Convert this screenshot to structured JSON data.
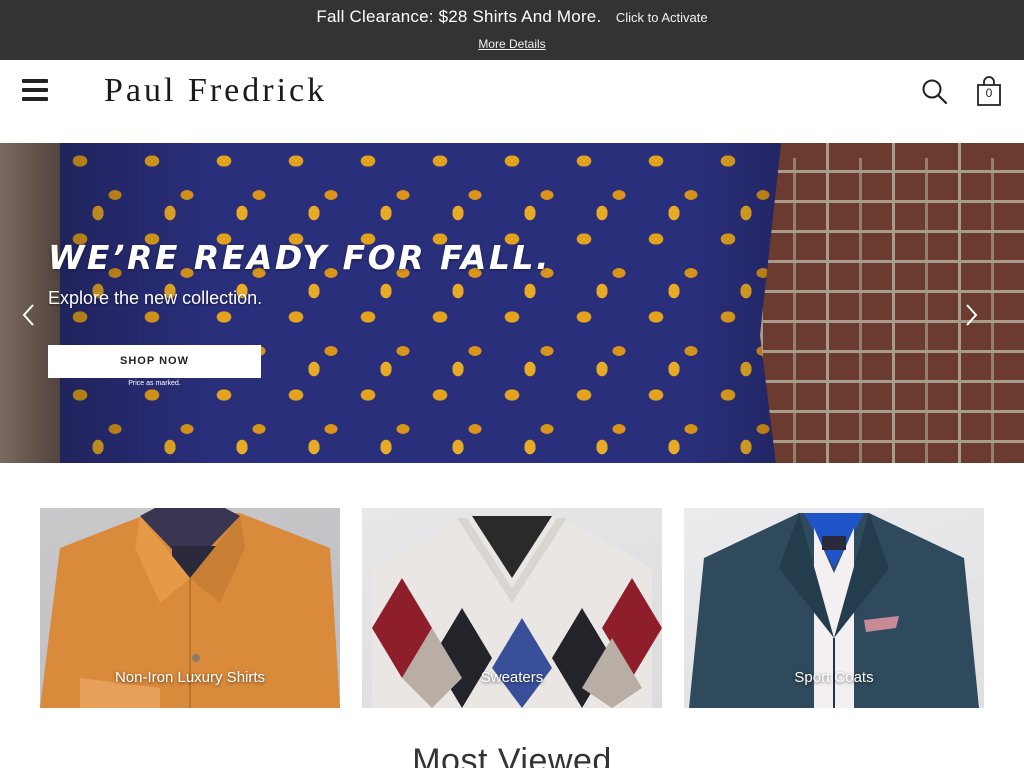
{
  "promo": {
    "title": "Fall Clearance: $28 Shirts And More.",
    "activate_label": "Click to Activate",
    "details_label": "More Details"
  },
  "header": {
    "logo_text": "Paul Fredrick",
    "menu_icon": "hamburger-menu-icon",
    "search_icon": "search-icon",
    "bag_icon": "shopping-bag-icon",
    "bag_count": "0"
  },
  "hero": {
    "headline": "WE’RE READY FOR FALL.",
    "subheadline": "Explore the new collection.",
    "cta_label": "SHOP NOW",
    "note": "Price as marked.",
    "prev_icon": "chevron-left-icon",
    "next_icon": "chevron-right-icon"
  },
  "categories": [
    {
      "label": "Non-Iron Luxury Shirts"
    },
    {
      "label": "Sweaters"
    },
    {
      "label": "Sport Coats"
    }
  ],
  "section_heading": "Most Viewed",
  "colors": {
    "promo_bg": "#333333",
    "shirt_navy": "#2a2f7c",
    "leaf_gold": "#e3a21d",
    "shirt_orange": "#d98a3a"
  }
}
